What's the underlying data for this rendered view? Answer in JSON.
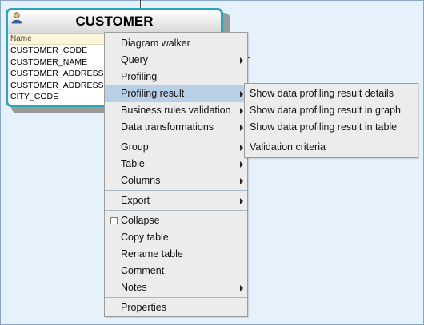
{
  "entity": {
    "title": "CUSTOMER",
    "column_header": "Name",
    "columns": [
      "CUSTOMER_CODE",
      "CUSTOMER_NAME",
      "CUSTOMER_ADDRESS_",
      "CUSTOMER_ADDRESS_",
      "CITY_CODE"
    ]
  },
  "context_menu": {
    "group1": [
      "Diagram walker",
      "Query",
      "Profiling",
      "Profiling result",
      "Business rules validation",
      "Data transformations"
    ],
    "group2": [
      "Group",
      "Table",
      "Columns"
    ],
    "group3": [
      "Export"
    ],
    "group4": [
      "Collapse",
      "Copy table",
      "Rename table",
      "Comment",
      "Notes"
    ],
    "group5": [
      "Properties"
    ]
  },
  "submenu": {
    "items": [
      "Show data profiling result details",
      "Show data profiling result in graph",
      "Show data profiling result in table"
    ],
    "extra": "Validation criteria"
  },
  "icons": {
    "entity": "person-icon",
    "submenu_arrow": "chevron-right-icon",
    "collapse": "checkbox-icon"
  },
  "colors": {
    "canvas": "#e6f2fb",
    "entity_border": "#2aa4b8",
    "menu_bg": "#ececec",
    "highlight": "#b8cfe5"
  }
}
